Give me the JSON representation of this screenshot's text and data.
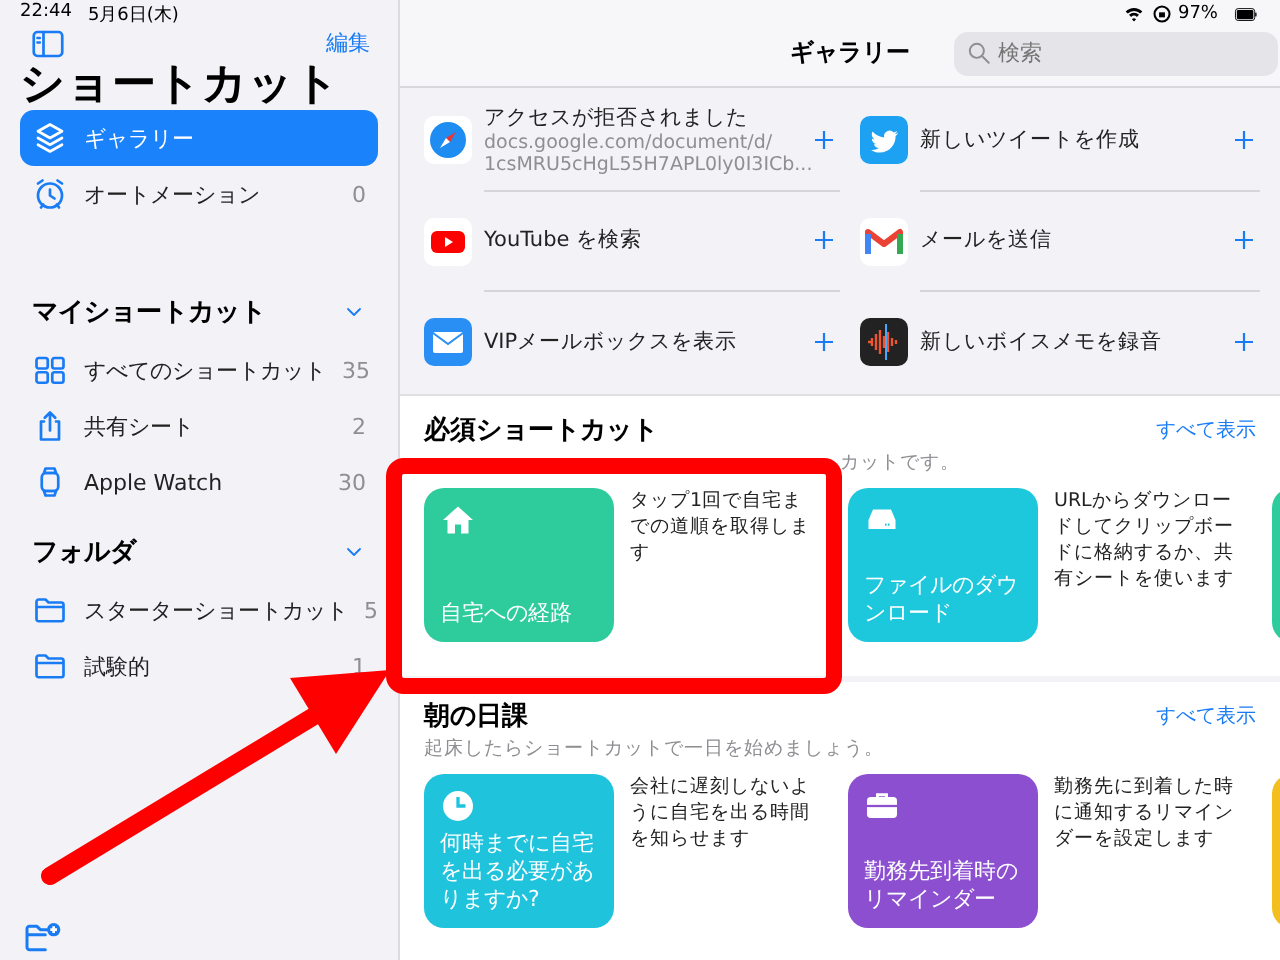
{
  "status_bar": {
    "time": "22:44",
    "date": "5月6日(木)",
    "battery": "97%"
  },
  "sidebar": {
    "edit": "編集",
    "title": "ショートカット",
    "top_items": [
      {
        "kind": "layers",
        "label": "ギャラリー",
        "selected": true
      },
      {
        "kind": "alarm",
        "label": "オートメーション",
        "count": "0",
        "selected": false
      }
    ],
    "sections": [
      {
        "title": "マイショートカット",
        "expanded": true,
        "items": [
          {
            "kind": "grid",
            "label": "すべてのショートカット",
            "count": "35",
            "selected": false
          },
          {
            "kind": "share",
            "label": "共有シート",
            "count": "2",
            "selected": false
          },
          {
            "kind": "watch",
            "label": "Apple Watch",
            "count": "30",
            "selected": false
          }
        ]
      },
      {
        "title": "フォルダ",
        "expanded": true,
        "items": [
          {
            "kind": "folder",
            "label": "スターターショートカット",
            "count": "5",
            "selected": false
          },
          {
            "kind": "folder",
            "label": "試験的",
            "count": "1",
            "selected": false
          }
        ]
      }
    ]
  },
  "header": {
    "title": "ギャラリー",
    "search": {
      "placeholder": "検索"
    }
  },
  "gallery": [
    {
      "kind": "compass",
      "title": "アクセスが拒否されました",
      "detail": [
        "docs.google.com/document/d/",
        "1csMRU5cHgL55H7APL0ly0I3ICb..."
      ]
    },
    {
      "kind": "bird",
      "title": "新しいツイートを作成"
    },
    {
      "kind": "play",
      "title": "YouTube を検索"
    },
    {
      "kind": "mletter",
      "title": "メールを送信"
    },
    {
      "kind": "envelope",
      "title": "VIPメールボックスを表示"
    },
    {
      "kind": "waveform",
      "title": "新しいボイスメモを録音"
    }
  ],
  "sections": [
    {
      "title": "必須ショートカット",
      "see_all": "すべて表示",
      "subtitle": "カットです。",
      "subtitle_hidden": true,
      "cards": [
        {
          "kind": "house",
          "title": "自宅への経路",
          "description": "タップ1回で自宅までの道順を取得します",
          "color": "#2ecb9c"
        },
        {
          "kind": "drive",
          "title": "ファイルのダウンロード",
          "description": "URLからダウンロードしてクリップボードに格納するか、共有シートを使います",
          "color": "#1ec8dc"
        },
        {
          "kind": "none",
          "color": "#2ecb9c"
        }
      ]
    },
    {
      "title": "朝の日課",
      "see_all": "すべて表示",
      "subtitle": "起床したらショートカットで一日を始めましょう。",
      "subtitle_hidden": false,
      "cards": [
        {
          "kind": "clock",
          "title": "何時までに自宅を出る必要がありますか?",
          "description": "会社に遅刻しないように自宅を出る時間を知らせます",
          "color": "#1fc3dc"
        },
        {
          "kind": "briefcase",
          "title": "勤務先到着時のリマインダー",
          "description": "勤務先に到着した時に通知するリマインダーを設定します",
          "color": "#8b4fcf"
        },
        {
          "kind": "none",
          "color": "#f2bf1e"
        }
      ]
    }
  ]
}
